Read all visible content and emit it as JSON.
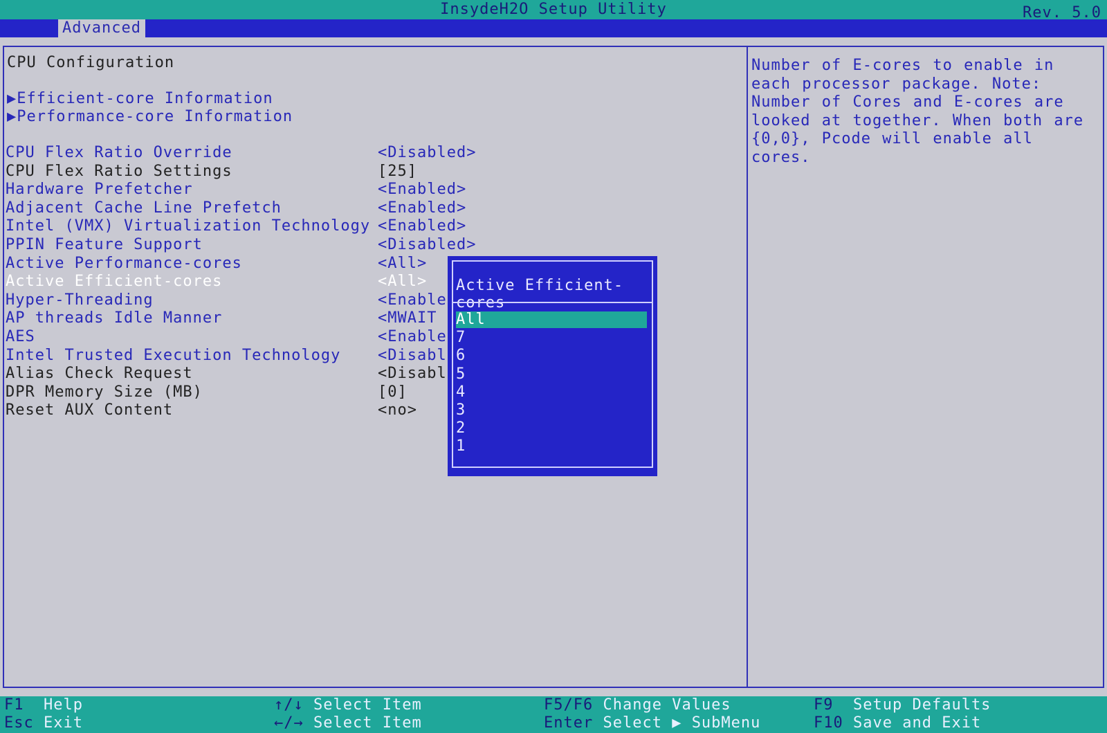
{
  "app": {
    "title": "InsydeH2O Setup Utility",
    "rev": "Rev. 5.0"
  },
  "menu": {
    "active_tab": "Advanced"
  },
  "section_title": "CPU Configuration",
  "submenus": [
    "▶Efficient-core Information",
    "▶Performance-core Information"
  ],
  "settings": [
    {
      "label": "CPU Flex Ratio Override",
      "value": "<Disabled>",
      "state": "editable"
    },
    {
      "label": "CPU Flex Ratio Settings",
      "value": "[25]",
      "state": "readonly"
    },
    {
      "label": "Hardware Prefetcher",
      "value": "<Enabled>",
      "state": "editable"
    },
    {
      "label": "Adjacent Cache Line Prefetch",
      "value": "<Enabled>",
      "state": "editable"
    },
    {
      "label": "Intel (VMX) Virtualization Technology",
      "value": "<Enabled>",
      "state": "editable"
    },
    {
      "label": "PPIN Feature Support",
      "value": "<Disabled>",
      "state": "editable"
    },
    {
      "label": "Active Performance-cores",
      "value": "<All>",
      "state": "editable"
    },
    {
      "label": "Active Efficient-cores",
      "value": "<All>",
      "state": "selected"
    },
    {
      "label": "Hyper-Threading",
      "value": "<Enabled",
      "state": "editable"
    },
    {
      "label": "AP threads Idle Manner",
      "value": "<MWAIT L",
      "state": "editable"
    },
    {
      "label": "AES",
      "value": "<Enabled",
      "state": "editable"
    },
    {
      "label": "Intel Trusted Execution Technology",
      "value": "<Disable",
      "state": "editable"
    },
    {
      "label": "Alias Check Request",
      "value": "<Disable",
      "state": "readonly"
    },
    {
      "label": "DPR Memory Size (MB)",
      "value": "[0]",
      "state": "readonly"
    },
    {
      "label": "Reset AUX Content",
      "value": "<no>",
      "state": "readonly"
    }
  ],
  "help_text": "Number of E-cores to enable in each processor package. Note: Number of Cores and E-cores are looked at together. When both are {0,0}, Pcode will enable all cores.",
  "popup": {
    "title": "Active Efficient-cores",
    "options": [
      "All",
      "7",
      "6",
      "5",
      "4",
      "3",
      "2",
      "1"
    ],
    "selected_index": 0
  },
  "footer": [
    {
      "key": "F1",
      "desc": "Help"
    },
    {
      "key": "Esc",
      "desc": "Exit"
    },
    {
      "key": "↑/↓",
      "desc": "Select Item"
    },
    {
      "key": "←/→",
      "desc": "Select Item"
    },
    {
      "key": "F5/F6",
      "desc": "Change Values"
    },
    {
      "key": "Enter",
      "desc": "Select ▶ SubMenu"
    },
    {
      "key": "F9",
      "desc": "Setup Defaults"
    },
    {
      "key": "F10",
      "desc": "Save and Exit"
    }
  ],
  "colors": {
    "accent_teal": "#1fa79a",
    "bios_blue": "#2424c8",
    "background": "#c9c9d2",
    "text_blue": "#2828b8"
  }
}
